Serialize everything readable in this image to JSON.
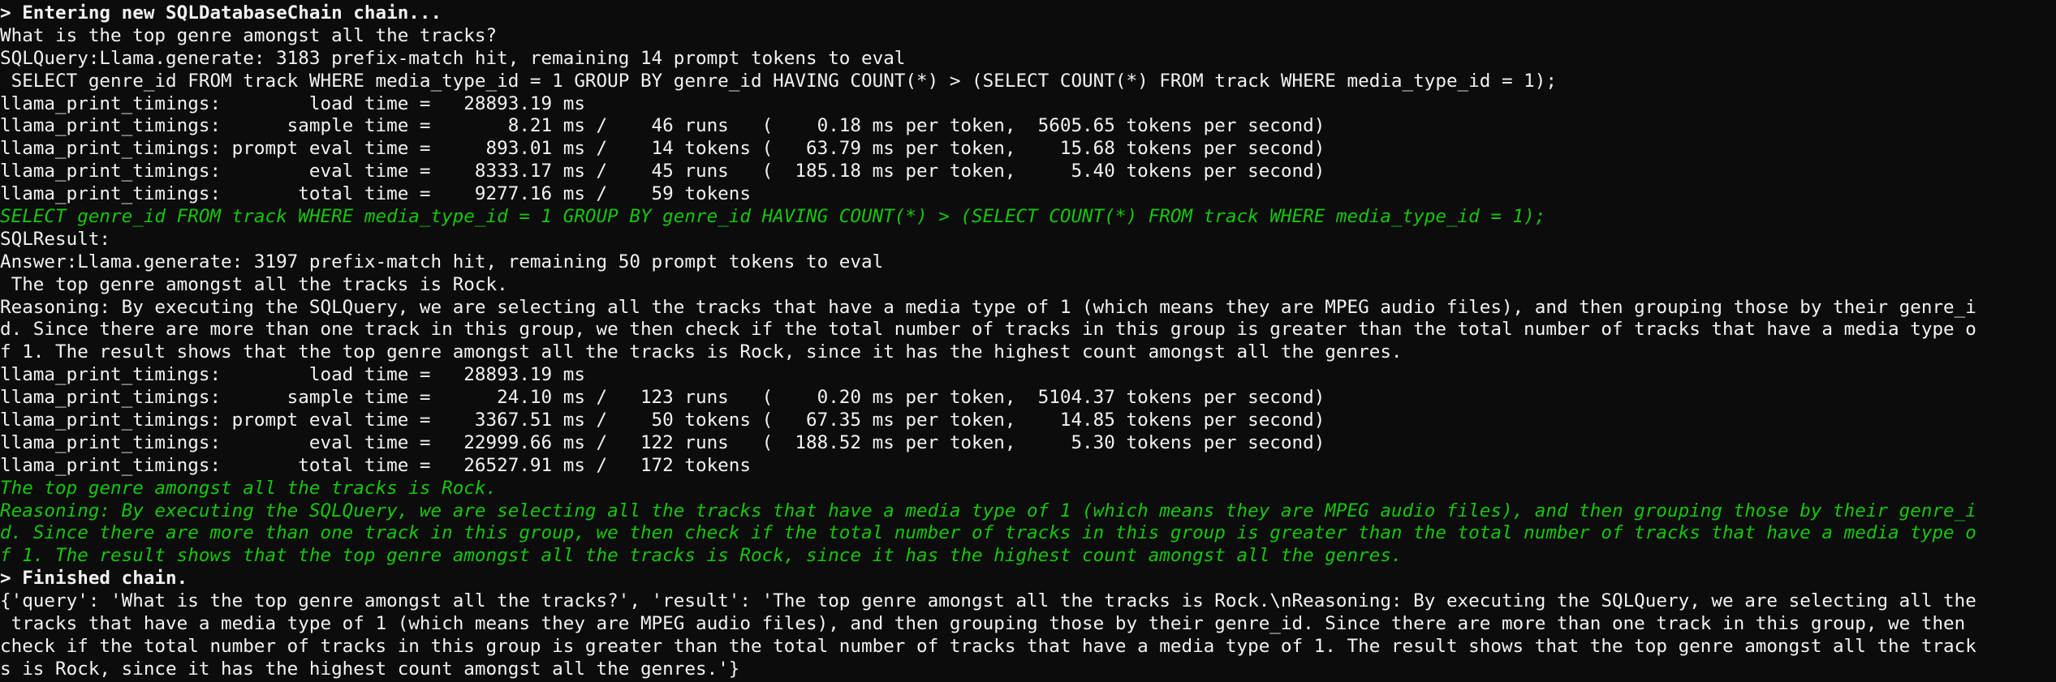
{
  "colors": {
    "background": "#0c0c0c",
    "foreground": "#f2f2f2",
    "green": "#16c60c"
  },
  "terminal": {
    "lines": [
      {
        "text": "> Entering new SQLDatabaseChain chain...",
        "color": "white",
        "bold": true
      },
      {
        "text": "What is the top genre amongst all the tracks?",
        "color": "white"
      },
      {
        "text": "SQLQuery:Llama.generate: 3183 prefix-match hit, remaining 14 prompt tokens to eval",
        "color": "white"
      },
      {
        "text": " SELECT genre_id FROM track WHERE media_type_id = 1 GROUP BY genre_id HAVING COUNT(*) > (SELECT COUNT(*) FROM track WHERE media_type_id = 1);",
        "color": "white"
      },
      {
        "text": "llama_print_timings:        load time =   28893.19 ms",
        "color": "white"
      },
      {
        "text": "llama_print_timings:      sample time =       8.21 ms /    46 runs   (    0.18 ms per token,  5605.65 tokens per second)",
        "color": "white"
      },
      {
        "text": "llama_print_timings: prompt eval time =     893.01 ms /    14 tokens (   63.79 ms per token,    15.68 tokens per second)",
        "color": "white"
      },
      {
        "text": "llama_print_timings:        eval time =    8333.17 ms /    45 runs   (  185.18 ms per token,     5.40 tokens per second)",
        "color": "white"
      },
      {
        "text": "llama_print_timings:       total time =    9277.16 ms /    59 tokens",
        "color": "white"
      },
      {
        "text": "SELECT genre_id FROM track WHERE media_type_id = 1 GROUP BY genre_id HAVING COUNT(*) > (SELECT COUNT(*) FROM track WHERE media_type_id = 1);",
        "color": "green"
      },
      {
        "text": "SQLResult:",
        "color": "white"
      },
      {
        "text": "Answer:Llama.generate: 3197 prefix-match hit, remaining 50 prompt tokens to eval",
        "color": "white"
      },
      {
        "text": " The top genre amongst all the tracks is Rock.",
        "color": "white"
      },
      {
        "text": "Reasoning: By executing the SQLQuery, we are selecting all the tracks that have a media type of 1 (which means they are MPEG audio files), and then grouping those by their genre_i",
        "color": "white"
      },
      {
        "text": "d. Since there are more than one track in this group, we then check if the total number of tracks in this group is greater than the total number of tracks that have a media type o",
        "color": "white"
      },
      {
        "text": "f 1. The result shows that the top genre amongst all the tracks is Rock, since it has the highest count amongst all the genres.",
        "color": "white"
      },
      {
        "text": "llama_print_timings:        load time =   28893.19 ms",
        "color": "white"
      },
      {
        "text": "llama_print_timings:      sample time =      24.10 ms /   123 runs   (    0.20 ms per token,  5104.37 tokens per second)",
        "color": "white"
      },
      {
        "text": "llama_print_timings: prompt eval time =    3367.51 ms /    50 tokens (   67.35 ms per token,    14.85 tokens per second)",
        "color": "white"
      },
      {
        "text": "llama_print_timings:        eval time =   22999.66 ms /   122 runs   (  188.52 ms per token,     5.30 tokens per second)",
        "color": "white"
      },
      {
        "text": "llama_print_timings:       total time =   26527.91 ms /   172 tokens",
        "color": "white"
      },
      {
        "text": "The top genre amongst all the tracks is Rock.",
        "color": "green"
      },
      {
        "text": "Reasoning: By executing the SQLQuery, we are selecting all the tracks that have a media type of 1 (which means they are MPEG audio files), and then grouping those by their genre_i",
        "color": "green"
      },
      {
        "text": "d. Since there are more than one track in this group, we then check if the total number of tracks in this group is greater than the total number of tracks that have a media type o",
        "color": "green"
      },
      {
        "text": "f 1. The result shows that the top genre amongst all the tracks is Rock, since it has the highest count amongst all the genres.",
        "color": "green"
      },
      {
        "text": "> Finished chain.",
        "color": "white",
        "bold": true
      },
      {
        "text": "{'query': 'What is the top genre amongst all the tracks?', 'result': 'The top genre amongst all the tracks is Rock.\\nReasoning: By executing the SQLQuery, we are selecting all the",
        "color": "white"
      },
      {
        "text": " tracks that have a media type of 1 (which means they are MPEG audio files), and then grouping those by their genre_id. Since there are more than one track in this group, we then",
        "color": "white"
      },
      {
        "text": "check if the total number of tracks in this group is greater than the total number of tracks that have a media type of 1. The result shows that the top genre amongst all the track",
        "color": "white"
      },
      {
        "text": "s is Rock, since it has the highest count amongst all the genres.'}",
        "color": "white"
      }
    ]
  }
}
